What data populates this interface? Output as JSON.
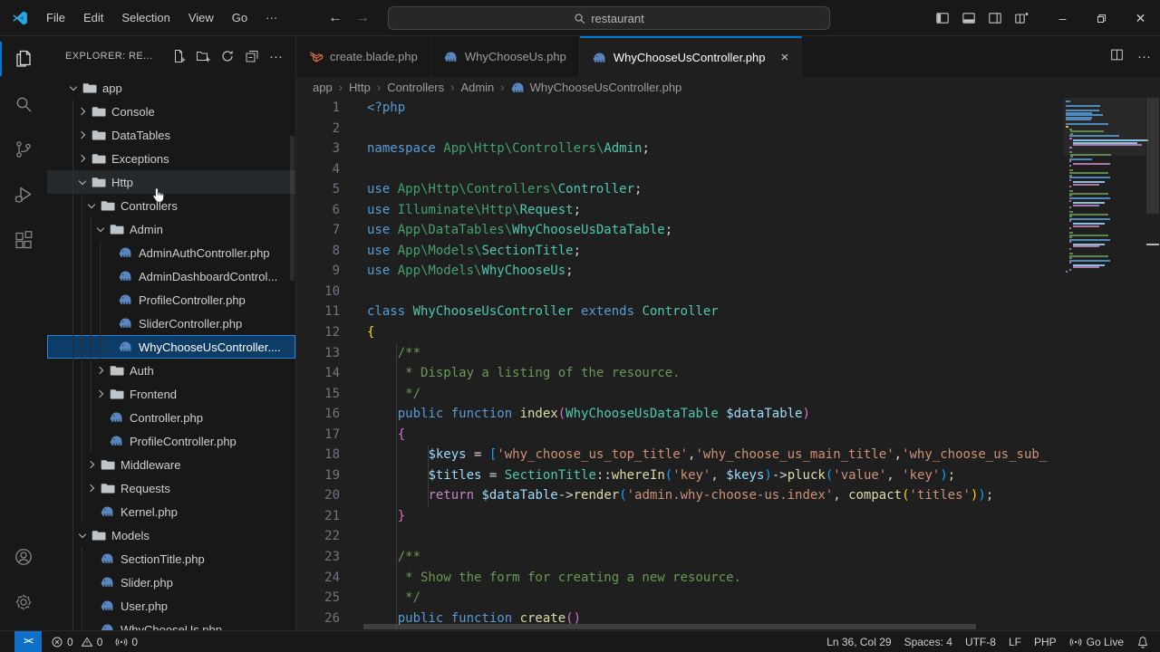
{
  "titlebar": {
    "menus": [
      "File",
      "Edit",
      "Selection",
      "View",
      "Go",
      "···"
    ],
    "search_value": "restaurant",
    "layout_icons": [
      "toggle-sidebar-left",
      "toggle-panel",
      "toggle-sidebar-right",
      "customize-layout"
    ],
    "window_icons": [
      "minimize",
      "restore",
      "close"
    ]
  },
  "activity_bar": {
    "top": [
      "explorer",
      "search",
      "source-control",
      "run-debug",
      "extensions"
    ],
    "bottom": [
      "account",
      "settings-gear"
    ]
  },
  "explorer": {
    "title": "EXPLORER: RE...",
    "actions": [
      "new-file",
      "new-folder",
      "refresh",
      "collapse-all",
      "more-actions"
    ],
    "tree": [
      {
        "label": "app",
        "level": 0,
        "type": "folder",
        "state": "expanded"
      },
      {
        "label": "Console",
        "level": 1,
        "type": "folder",
        "state": "collapsed"
      },
      {
        "label": "DataTables",
        "level": 1,
        "type": "folder",
        "state": "collapsed"
      },
      {
        "label": "Exceptions",
        "level": 1,
        "type": "folder",
        "state": "collapsed"
      },
      {
        "label": "Http",
        "level": 1,
        "type": "folder",
        "state": "expanded",
        "hover": true
      },
      {
        "label": "Controllers",
        "level": 2,
        "type": "folder",
        "state": "expanded"
      },
      {
        "label": "Admin",
        "level": 3,
        "type": "folder",
        "state": "expanded"
      },
      {
        "label": "AdminAuthController.php",
        "level": 4,
        "type": "php"
      },
      {
        "label": "AdminDashboardControl...",
        "level": 4,
        "type": "php"
      },
      {
        "label": "ProfileController.php",
        "level": 4,
        "type": "php"
      },
      {
        "label": "SliderController.php",
        "level": 4,
        "type": "php"
      },
      {
        "label": "WhyChooseUsController....",
        "level": 4,
        "type": "php",
        "selected": true
      },
      {
        "label": "Auth",
        "level": 3,
        "type": "folder",
        "state": "collapsed"
      },
      {
        "label": "Frontend",
        "level": 3,
        "type": "folder",
        "state": "collapsed"
      },
      {
        "label": "Controller.php",
        "level": 3,
        "type": "php"
      },
      {
        "label": "ProfileController.php",
        "level": 3,
        "type": "php"
      },
      {
        "label": "Middleware",
        "level": 2,
        "type": "folder",
        "state": "collapsed"
      },
      {
        "label": "Requests",
        "level": 2,
        "type": "folder",
        "state": "collapsed"
      },
      {
        "label": "Kernel.php",
        "level": 2,
        "type": "php"
      },
      {
        "label": "Models",
        "level": 1,
        "type": "folder",
        "state": "expanded"
      },
      {
        "label": "SectionTitle.php",
        "level": 2,
        "type": "php"
      },
      {
        "label": "Slider.php",
        "level": 2,
        "type": "php"
      },
      {
        "label": "User.php",
        "level": 2,
        "type": "php"
      },
      {
        "label": "WhyChooseUs.php",
        "level": 2,
        "type": "php",
        "partial": true
      }
    ]
  },
  "tabs": [
    {
      "label": "create.blade.php",
      "icon": "laravel",
      "active": false
    },
    {
      "label": "WhyChooseUs.php",
      "icon": "php",
      "active": false
    },
    {
      "label": "WhyChooseUsController.php",
      "icon": "php",
      "active": true,
      "close": "×"
    }
  ],
  "breadcrumb": [
    "app",
    "Http",
    "Controllers",
    "Admin",
    "WhyChooseUsController.php"
  ],
  "code": {
    "lines": [
      {
        "n": 1,
        "t": [
          [
            "<?php",
            "kw"
          ]
        ]
      },
      {
        "n": 2,
        "t": []
      },
      {
        "n": 3,
        "t": [
          [
            "namespace ",
            "kw"
          ],
          [
            "App\\Http\\Controllers\\",
            "ns"
          ],
          [
            "Admin",
            "cls"
          ],
          [
            ";",
            "pun"
          ]
        ]
      },
      {
        "n": 4,
        "t": []
      },
      {
        "n": 5,
        "t": [
          [
            "use ",
            "kw"
          ],
          [
            "App\\Http\\Controllers\\",
            "ns"
          ],
          [
            "Controller",
            "cls"
          ],
          [
            ";",
            "pun"
          ]
        ]
      },
      {
        "n": 6,
        "t": [
          [
            "use ",
            "kw"
          ],
          [
            "Illuminate\\Http\\",
            "ns"
          ],
          [
            "Request",
            "cls"
          ],
          [
            ";",
            "pun"
          ]
        ]
      },
      {
        "n": 7,
        "t": [
          [
            "use ",
            "kw"
          ],
          [
            "App\\DataTables\\",
            "ns"
          ],
          [
            "WhyChooseUsDataTable",
            "cls"
          ],
          [
            ";",
            "pun"
          ]
        ]
      },
      {
        "n": 8,
        "t": [
          [
            "use ",
            "kw"
          ],
          [
            "App\\Models\\",
            "ns"
          ],
          [
            "SectionTitle",
            "cls"
          ],
          [
            ";",
            "pun"
          ]
        ]
      },
      {
        "n": 9,
        "t": [
          [
            "use ",
            "kw"
          ],
          [
            "App\\Models\\",
            "ns"
          ],
          [
            "WhyChooseUs",
            "cls"
          ],
          [
            ";",
            "pun"
          ]
        ]
      },
      {
        "n": 10,
        "t": []
      },
      {
        "n": 11,
        "t": [
          [
            "class ",
            "kw"
          ],
          [
            "WhyChooseUsController ",
            "cls"
          ],
          [
            "extends ",
            "kw"
          ],
          [
            "Controller",
            "cls"
          ]
        ]
      },
      {
        "n": 12,
        "t": [
          [
            "{",
            "b1"
          ]
        ]
      },
      {
        "n": 13,
        "t": [
          [
            "    /**",
            "com"
          ]
        ]
      },
      {
        "n": 14,
        "t": [
          [
            "     * Display a listing of the resource.",
            "com"
          ]
        ]
      },
      {
        "n": 15,
        "t": [
          [
            "     */",
            "com"
          ]
        ]
      },
      {
        "n": 16,
        "t": [
          [
            "    ",
            "pun"
          ],
          [
            "public function ",
            "kw"
          ],
          [
            "index",
            "fn"
          ],
          [
            "(",
            "b2"
          ],
          [
            "WhyChooseUsDataTable ",
            "cls"
          ],
          [
            "$dataTable",
            "var"
          ],
          [
            ")",
            "b2"
          ]
        ]
      },
      {
        "n": 17,
        "t": [
          [
            "    {",
            "b2"
          ]
        ]
      },
      {
        "n": 18,
        "t": [
          [
            "        ",
            "pun"
          ],
          [
            "$keys",
            "var"
          ],
          [
            " = ",
            "pun"
          ],
          [
            "[",
            "b3"
          ],
          [
            "'why_choose_us_top_title'",
            "str"
          ],
          [
            ",",
            "pun"
          ],
          [
            "'why_choose_us_main_title'",
            "str"
          ],
          [
            ",",
            "pun"
          ],
          [
            "'why_choose_us_sub_",
            "str"
          ]
        ]
      },
      {
        "n": 19,
        "t": [
          [
            "        ",
            "pun"
          ],
          [
            "$titles",
            "var"
          ],
          [
            " = ",
            "pun"
          ],
          [
            "SectionTitle",
            "cls"
          ],
          [
            "::",
            "pun"
          ],
          [
            "whereIn",
            "fn"
          ],
          [
            "(",
            "b3"
          ],
          [
            "'key'",
            "str"
          ],
          [
            ", ",
            "pun"
          ],
          [
            "$keys",
            "var"
          ],
          [
            ")",
            "b3"
          ],
          [
            "->",
            "pun"
          ],
          [
            "pluck",
            "fn"
          ],
          [
            "(",
            "b3"
          ],
          [
            "'value'",
            "str"
          ],
          [
            ", ",
            "pun"
          ],
          [
            "'key'",
            "str"
          ],
          [
            ")",
            "b3"
          ],
          [
            ";",
            "pun"
          ]
        ]
      },
      {
        "n": 20,
        "t": [
          [
            "        ",
            "pun"
          ],
          [
            "return ",
            "ctrl"
          ],
          [
            "$dataTable",
            "var"
          ],
          [
            "->",
            "pun"
          ],
          [
            "render",
            "fn"
          ],
          [
            "(",
            "b3"
          ],
          [
            "'admin.why-choose-us.index'",
            "str"
          ],
          [
            ", ",
            "pun"
          ],
          [
            "compact",
            "fn"
          ],
          [
            "(",
            "b1"
          ],
          [
            "'titles'",
            "str"
          ],
          [
            ")",
            "b1"
          ],
          [
            ")",
            "b3"
          ],
          [
            ";",
            "pun"
          ]
        ]
      },
      {
        "n": 21,
        "t": [
          [
            "    }",
            "b2"
          ]
        ]
      },
      {
        "n": 22,
        "t": []
      },
      {
        "n": 23,
        "t": [
          [
            "    /**",
            "com"
          ]
        ]
      },
      {
        "n": 24,
        "t": [
          [
            "     * Show the form for creating a new resource.",
            "com"
          ]
        ]
      },
      {
        "n": 25,
        "t": [
          [
            "     */",
            "com"
          ]
        ]
      },
      {
        "n": 26,
        "t": [
          [
            "    ",
            "pun"
          ],
          [
            "public function ",
            "kw"
          ],
          [
            "create",
            "fn"
          ],
          [
            "()",
            "b2"
          ]
        ]
      }
    ]
  },
  "status": {
    "remote": "><",
    "errors": "0",
    "warnings": "0",
    "ports": "0",
    "line_col": "Ln 36, Col 29",
    "spaces": "Spaces: 4",
    "encoding": "UTF-8",
    "eol": "LF",
    "language": "PHP",
    "go_live": "Go Live"
  },
  "colors": {
    "accent": "#0078d4",
    "remote_indicator_bg": "#0e70c8",
    "list_selection_bg": "#0d3c66",
    "php_icon": "#5a86c0",
    "laravel_icon": "#e8734f",
    "syntax": {
      "keyword": "#569cd6",
      "control": "#c586c0",
      "namespace": "#43a16f",
      "class": "#4ec9b0",
      "function": "#dcdcaa",
      "variable": "#9cdcfe",
      "string": "#ce9178",
      "comment": "#6a9955",
      "bracket1": "#ffd700",
      "bracket2": "#da70d6",
      "bracket3": "#179fff"
    }
  }
}
